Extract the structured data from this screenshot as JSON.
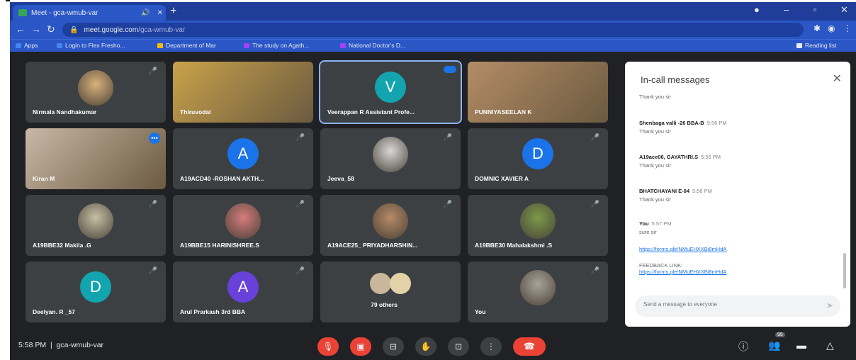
{
  "browser": {
    "tab_title": "Meet - gca-wmub-var",
    "tab_speaker_icon": "speaker-icon",
    "new_tab_label": "+",
    "url_host": "meet.google.com",
    "url_path": "/gca-wmub-var",
    "bookmarks": [
      {
        "label": "Apps",
        "color": "#4285f4"
      },
      {
        "label": "Login to Flex Fresho...",
        "color": "#4285f4"
      },
      {
        "label": "Department of Mar",
        "color": "#fbbc04"
      },
      {
        "label": "The study on Agath...",
        "color": "#a142f4"
      },
      {
        "label": "National Doctor's D...",
        "color": "#a142f4"
      }
    ],
    "reading_list_label": "Reading list"
  },
  "participants": [
    {
      "name": "Nirmala Nandhakumar",
      "kind": "photo",
      "color": "#d9b27a"
    },
    {
      "name": "Thiruvodal",
      "kind": "video",
      "color": "#c9a24a"
    },
    {
      "name": "Veerappan R Assistant Profe...",
      "kind": "avatar",
      "initial": "V",
      "color": "#12a4af"
    },
    {
      "name": "PUNNIYASEELAN K",
      "kind": "video",
      "color": "#b48c66"
    },
    {
      "name": "Kiran M",
      "kind": "video",
      "color": "#c8b8a6"
    },
    {
      "name": "A19ACD40 -ROSHAN AKTH...",
      "kind": "avatar",
      "initial": "A",
      "color": "#1a73e8"
    },
    {
      "name": "Jeeva_58",
      "kind": "photo",
      "color": "#d8d8d8"
    },
    {
      "name": "DOMNIC XAVIER A",
      "kind": "avatar",
      "initial": "D",
      "color": "#1a73e8"
    },
    {
      "name": "A19BBE32 Makila .G",
      "kind": "photo",
      "color": "#c6c0a5"
    },
    {
      "name": "A19BBE15 HARINISHREE.S",
      "kind": "photo",
      "color": "#d67c7c"
    },
    {
      "name": "A19ACE25_ PRIYADHARSHIN...",
      "kind": "photo",
      "color": "#b68a66"
    },
    {
      "name": "A19BBE30 Mahalakshmi .S",
      "kind": "photo",
      "color": "#7b9a4a"
    },
    {
      "name": "Deelyan. R _57",
      "kind": "avatar",
      "initial": "D",
      "color": "#12a4af"
    },
    {
      "name": "Arul Prarkash 3rd BBA",
      "kind": "avatar",
      "initial": "A",
      "color": "#6741d9"
    },
    {
      "name": "79 others",
      "kind": "others",
      "color": "#c8b79a"
    },
    {
      "name": "You",
      "kind": "photo",
      "color": "#a8a39a"
    }
  ],
  "chat": {
    "title": "In-call messages",
    "messages": [
      {
        "sender": "",
        "time": "",
        "text": "Thank you sir"
      },
      {
        "sender": "Shenbaga valli -26 BBA-B",
        "time": "5:56 PM",
        "text": "Thank you sir"
      },
      {
        "sender": "A19ace06, GAYATHRI.S",
        "time": "5:56 PM",
        "text": "Thank you sir"
      },
      {
        "sender": "BHATCHAYANI E-04",
        "time": "5:56 PM",
        "text": "Thank you sir"
      },
      {
        "sender": "You",
        "time": "5:57 PM",
        "text": "sure sir"
      },
      {
        "sender": "",
        "time": "",
        "link": "https://forms.gle/NMuEHXXBi8mHdA"
      },
      {
        "sender": "",
        "time": "",
        "text": "FEEDBACK LINK:",
        "link": "https://forms.gle/NMuEHXXBi8mHdA"
      }
    ],
    "input_placeholder": "Send a message to everyone"
  },
  "bottom": {
    "time": "5:58 PM",
    "meeting_code": "gca-wmub-var",
    "participant_count": "95"
  }
}
